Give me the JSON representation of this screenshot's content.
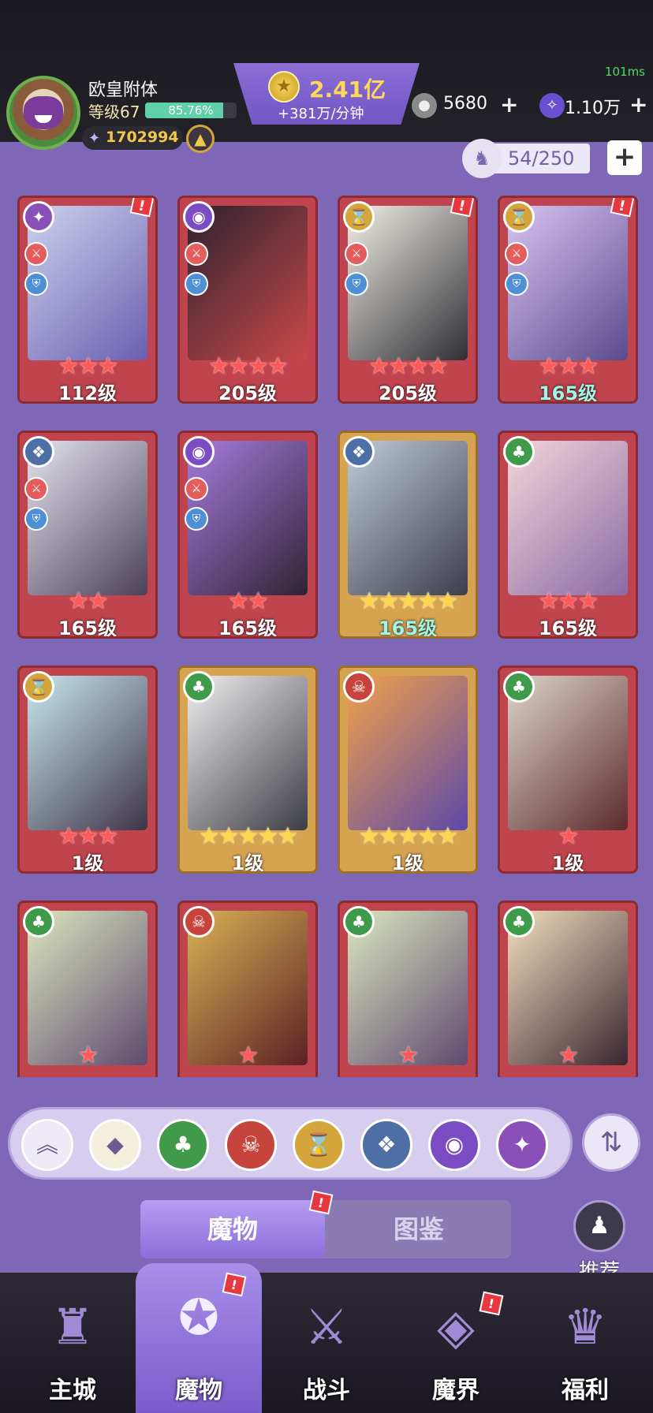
{
  "status": {
    "ping": "101ms"
  },
  "player": {
    "name": "欧皇附体",
    "level": "等级67",
    "xp_percent": "85.76%",
    "xp_fraction": 0.8576,
    "power": "1702994",
    "upgrade_icon": "arrow-up-icon"
  },
  "currency": {
    "gold": "2.41亿",
    "gold_rate": "+381万/分钟",
    "silver": "5680",
    "gems": "1.10万",
    "plus": "+"
  },
  "capacity": {
    "value": "54/250",
    "plus": "+"
  },
  "cards": [
    {
      "level": "112级",
      "stars": "★★★",
      "frame": "red",
      "element": "sand",
      "alert": "!",
      "teal": false
    },
    {
      "level": "205级",
      "stars": "★★★★",
      "frame": "red",
      "element": "eye",
      "alert": "",
      "teal": false
    },
    {
      "level": "205级",
      "stars": "★★★★",
      "frame": "red",
      "element": "hourglass",
      "alert": "!",
      "teal": false
    },
    {
      "level": "165级",
      "stars": "★★★",
      "frame": "red",
      "element": "hourglass",
      "alert": "!",
      "teal": true
    },
    {
      "level": "165级",
      "stars": "★★",
      "frame": "red",
      "element": "dragon",
      "alert": "",
      "teal": false
    },
    {
      "level": "165级",
      "stars": "★★",
      "frame": "red",
      "element": "eye",
      "alert": "",
      "teal": false
    },
    {
      "level": "165级",
      "stars": "★★★★★",
      "frame": "gold",
      "element": "dragon",
      "alert": "",
      "teal": true
    },
    {
      "level": "165级",
      "stars": "★★★",
      "frame": "red",
      "element": "leaf",
      "alert": "",
      "teal": false
    },
    {
      "level": "1级",
      "stars": "★★★",
      "frame": "red",
      "element": "hourglass",
      "alert": "",
      "teal": false
    },
    {
      "level": "1级",
      "stars": "★★★★★",
      "frame": "gold",
      "element": "leaf",
      "alert": "",
      "teal": false
    },
    {
      "level": "1级",
      "stars": "★★★★★",
      "frame": "gold",
      "element": "demon",
      "alert": "",
      "teal": false
    },
    {
      "level": "1级",
      "stars": "★",
      "frame": "red",
      "element": "leaf",
      "alert": "",
      "teal": false
    },
    {
      "level": "",
      "stars": "★",
      "frame": "red",
      "element": "leaf",
      "alert": "",
      "teal": false
    },
    {
      "level": "",
      "stars": "★",
      "frame": "red",
      "element": "demon",
      "alert": "",
      "teal": false
    },
    {
      "level": "",
      "stars": "★",
      "frame": "red",
      "element": "leaf",
      "alert": "",
      "teal": false
    },
    {
      "level": "",
      "stars": "★",
      "frame": "red",
      "element": "leaf",
      "alert": "",
      "teal": false
    }
  ],
  "filters": [
    {
      "name": "collapse",
      "glyph": "︽",
      "color": "#eeeaf6"
    },
    {
      "name": "all",
      "glyph": "◆",
      "color": "#f4eedc"
    },
    {
      "name": "leaf",
      "glyph": "♣",
      "color": "#3f9a4a"
    },
    {
      "name": "demon",
      "glyph": "☠",
      "color": "#c7443c"
    },
    {
      "name": "hourglass",
      "glyph": "⌛",
      "color": "#d3a53b"
    },
    {
      "name": "dragon",
      "glyph": "❖",
      "color": "#4d6fa6"
    },
    {
      "name": "eye",
      "glyph": "◉",
      "color": "#7b4cc2"
    },
    {
      "name": "sand",
      "glyph": "✦",
      "color": "#8a4fb9"
    }
  ],
  "sort_icon": "sort-icon",
  "tabs": {
    "active": "魔物",
    "inactive": "图鉴",
    "alert": "!"
  },
  "recommend": {
    "label": "推荐"
  },
  "nav": [
    {
      "label": "主城",
      "icon": "castle-icon",
      "alert": ""
    },
    {
      "label": "魔物",
      "icon": "monster-icon",
      "alert": "!"
    },
    {
      "label": "战斗",
      "icon": "sword-icon",
      "alert": ""
    },
    {
      "label": "魔界",
      "icon": "portal-icon",
      "alert": "!"
    },
    {
      "label": "福利",
      "icon": "chest-icon",
      "alert": ""
    }
  ],
  "colors": {
    "background": "#7f67b8",
    "red_frame": "#c0444d",
    "gold_frame": "#d6a351",
    "gold_text": "#ffd75a"
  }
}
